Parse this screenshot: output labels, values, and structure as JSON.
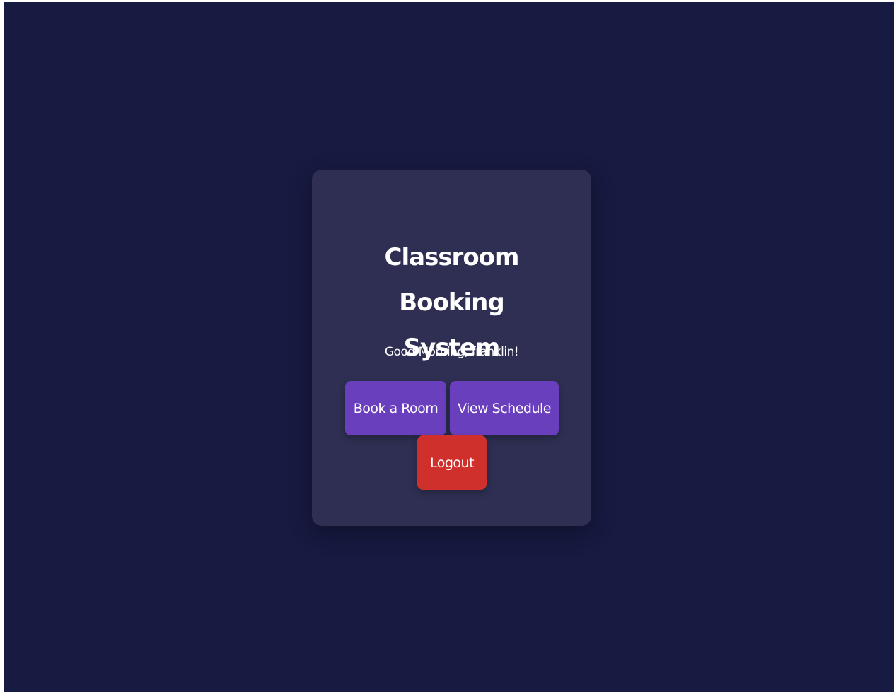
{
  "app": {
    "title_line1": "Classroom Booking",
    "title_line2": "System",
    "greeting": "Good Morning, franklin!"
  },
  "actions": {
    "book_label": "Book a Room",
    "schedule_label": "View Schedule",
    "logout_label": "Logout"
  },
  "colors": {
    "background": "#171a41",
    "card": "#2e2f52",
    "primary_button": "#6a3fbd",
    "danger_button": "#d0302c",
    "text": "#ffffff"
  }
}
